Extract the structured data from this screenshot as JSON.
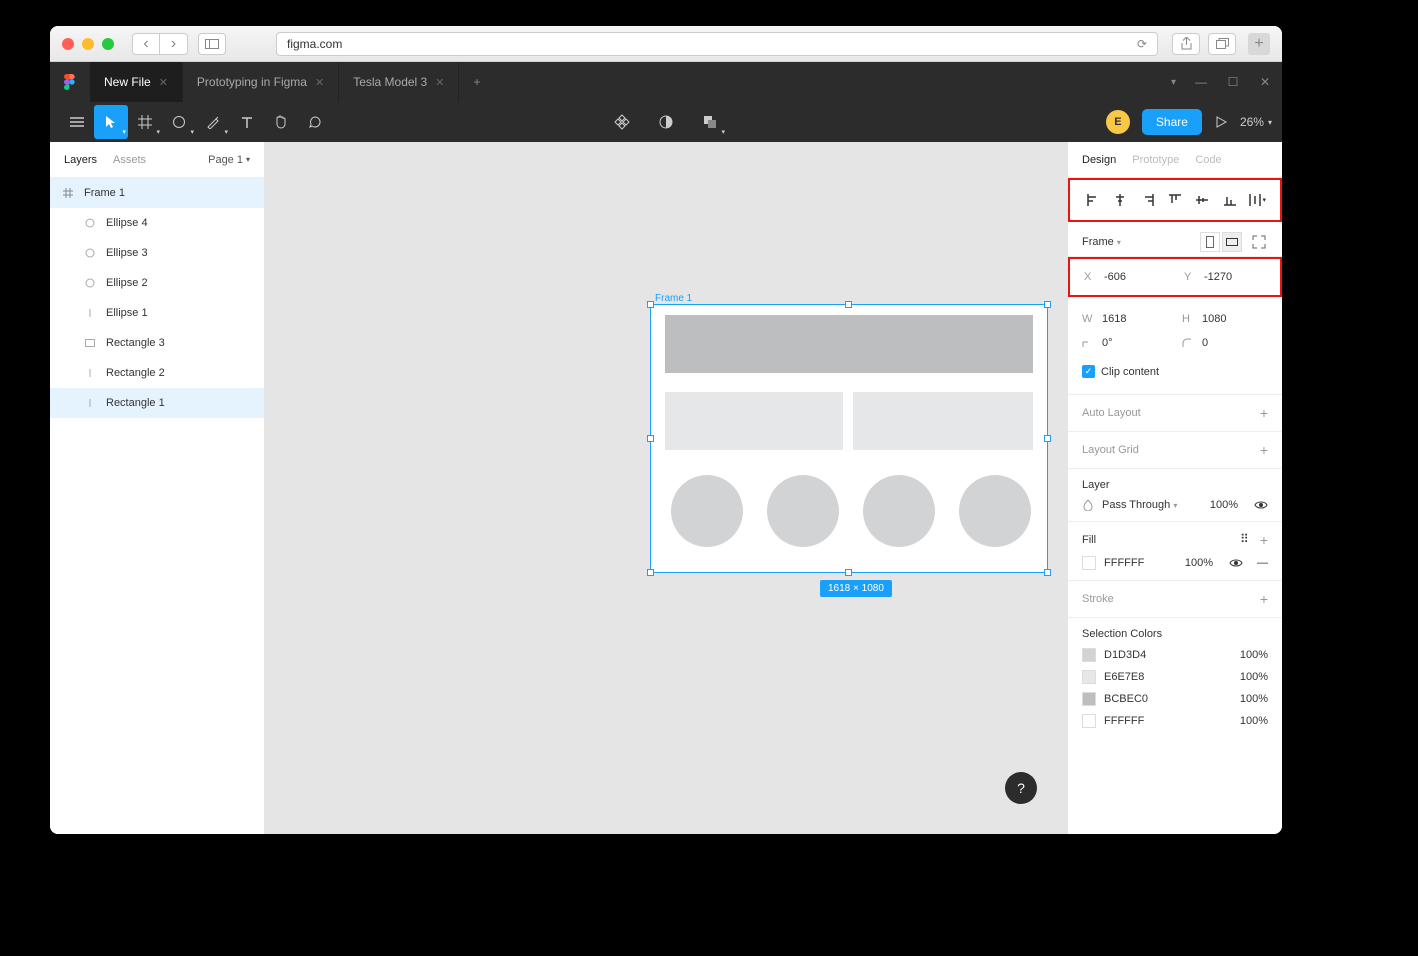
{
  "browser": {
    "url": "figma.com"
  },
  "figma_tabs": [
    "New File",
    "Prototyping in Figma",
    "Tesla Model 3"
  ],
  "toolbar": {
    "avatar_initial": "E",
    "share": "Share",
    "zoom": "26%"
  },
  "layers": {
    "tabs": [
      "Layers",
      "Assets"
    ],
    "page": "Page 1",
    "items": [
      {
        "name": "Frame 1",
        "type": "frame"
      },
      {
        "name": "Ellipse 4",
        "type": "ellipse"
      },
      {
        "name": "Ellipse 3",
        "type": "ellipse"
      },
      {
        "name": "Ellipse 2",
        "type": "ellipse"
      },
      {
        "name": "Ellipse 1",
        "type": "ellipse"
      },
      {
        "name": "Rectangle 3",
        "type": "rect"
      },
      {
        "name": "Rectangle 2",
        "type": "rect"
      },
      {
        "name": "Rectangle 1",
        "type": "rect"
      }
    ]
  },
  "canvas": {
    "frame_label": "Frame 1",
    "frame_dims": "1618 × 1080"
  },
  "design": {
    "tabs": [
      "Design",
      "Prototype",
      "Code"
    ],
    "frame_label": "Frame",
    "x": "-606",
    "y": "-1270",
    "w": "1618",
    "h": "1080",
    "rotation": "0°",
    "radius": "0",
    "clip": "Clip content",
    "auto_layout": "Auto Layout",
    "layout_grid": "Layout Grid",
    "layer_head": "Layer",
    "blend": "Pass Through",
    "blend_pct": "100%",
    "fill_head": "Fill",
    "fill_hex": "FFFFFF",
    "fill_pct": "100%",
    "stroke_head": "Stroke",
    "sel_colors_head": "Selection Colors",
    "sel_colors": [
      {
        "hex": "D1D3D4",
        "pct": "100%"
      },
      {
        "hex": "E6E7E8",
        "pct": "100%"
      },
      {
        "hex": "BCBEC0",
        "pct": "100%"
      },
      {
        "hex": "FFFFFF",
        "pct": "100%"
      }
    ]
  }
}
